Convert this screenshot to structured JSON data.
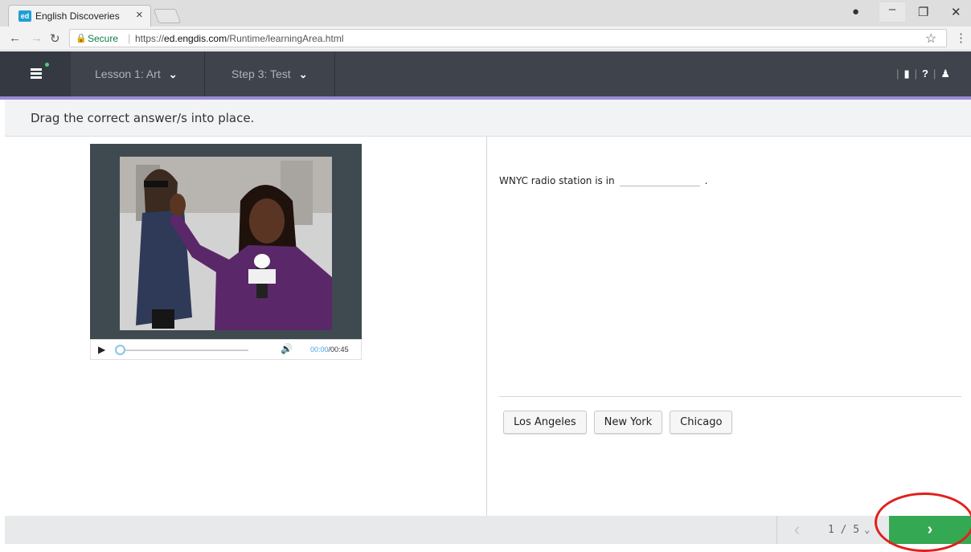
{
  "browser": {
    "tab_title": "English Discoveries",
    "favicon_text": "ed",
    "close_glyph": "×",
    "secure_label": "Secure",
    "url_prefix": "https://",
    "url_host": "ed.engdis.com",
    "url_path": "/Runtime/learningArea.html"
  },
  "header": {
    "lesson_label": "Lesson 1: Art",
    "step_label": "Step 3: Test",
    "help_glyph": "?"
  },
  "instruction": "Drag the correct answer/s into place.",
  "video": {
    "current_time": "00:00",
    "total_time": "00:45"
  },
  "question": {
    "prefix": "WNYC radio station is in",
    "suffix": "."
  },
  "answers": [
    "Los Angeles",
    "New York",
    "Chicago"
  ],
  "footer": {
    "page_indicator": "1 / 5"
  },
  "colors": {
    "header_bg": "#3e434c",
    "accent_purple": "#9a8bd6",
    "next_green": "#35a853",
    "highlight_red": "#e0201b"
  }
}
